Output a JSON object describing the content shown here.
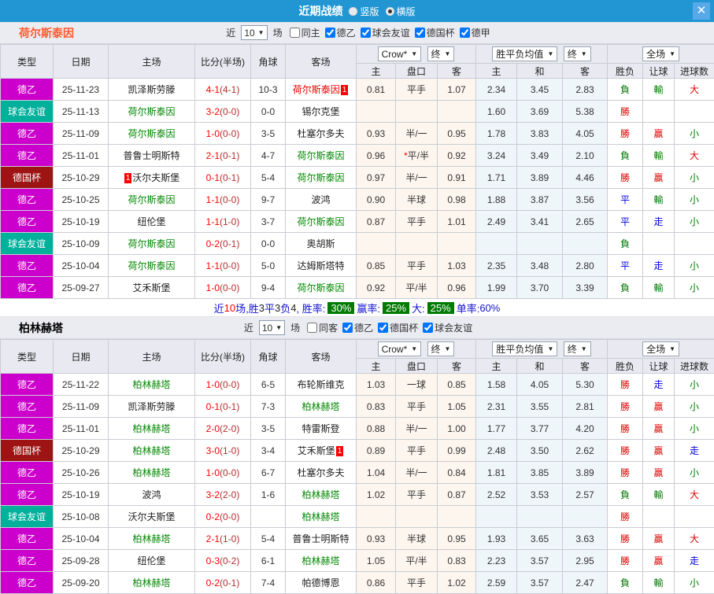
{
  "titlebar": {
    "title": "近期战绩",
    "radios": [
      {
        "label": "竖版",
        "selected": false
      },
      {
        "label": "横版",
        "selected": true
      }
    ],
    "close": "✕"
  },
  "table_header": {
    "cols": [
      "类型",
      "日期",
      "主场",
      "比分(半场)",
      "角球",
      "客场"
    ],
    "dropdowns": {
      "crow": "Crow*",
      "final1": "终",
      "avg": "胜平负均值",
      "final2": "终",
      "scope": "全场"
    },
    "sub": [
      "主",
      "盘口",
      "客",
      "主",
      "和",
      "客",
      "胜负",
      "让球",
      "进球数"
    ]
  },
  "colors": {
    "topbar": "#2196d3",
    "league": {
      "德乙": "#cc00cc",
      "球会友谊": "#00b09b",
      "德国杯": "#9e1414"
    },
    "team": {
      "green": "#008800",
      "red": "#e60000",
      "black": "#222222"
    },
    "result": {
      "red": "#e00000",
      "green": "#007a00",
      "blue": "#0000dd"
    },
    "title_orange": "#ff5a2a",
    "title_black": "#000000"
  },
  "sections": [
    {
      "team": "荷尔斯泰因",
      "team_color": "#ff5a2a",
      "filter": {
        "near": "近",
        "count": "10",
        "matches": "场",
        "checks": [
          {
            "label": "同主",
            "checked": false
          },
          {
            "label": "德乙",
            "checked": true
          },
          {
            "label": "球会友谊",
            "checked": true
          },
          {
            "label": "德国杯",
            "checked": true
          },
          {
            "label": "德甲",
            "checked": true
          }
        ]
      },
      "rows": [
        {
          "type": "德乙",
          "date": "25-11-23",
          "home": {
            "name": "凯泽斯劳滕",
            "color": "black"
          },
          "score": "4-1",
          "half": "(4-1)",
          "corner": "10-3",
          "away": {
            "name": "荷尔斯泰因",
            "color": "red",
            "badge": "1",
            "badge_pos": "after"
          },
          "odds": [
            "0.81",
            "平手",
            "1.07",
            "2.34",
            "3.45",
            "2.83"
          ],
          "results": [
            {
              "t": "負",
              "c": "green"
            },
            {
              "t": "輸",
              "c": "green"
            },
            {
              "t": "大",
              "c": "red"
            }
          ]
        },
        {
          "type": "球会友谊",
          "date": "25-11-13",
          "home": {
            "name": "荷尔斯泰因",
            "color": "green"
          },
          "score": "3-2",
          "half": "(0-0)",
          "corner": "0-0",
          "away": {
            "name": "锡尔克堡",
            "color": "black"
          },
          "odds": [
            "",
            "",
            "",
            "1.60",
            "3.69",
            "5.38"
          ],
          "results": [
            {
              "t": "勝",
              "c": "red"
            },
            null,
            null
          ]
        },
        {
          "type": "德乙",
          "date": "25-11-09",
          "home": {
            "name": "荷尔斯泰因",
            "color": "green"
          },
          "score": "1-0",
          "half": "(0-0)",
          "corner": "3-5",
          "away": {
            "name": "杜塞尔多夫",
            "color": "black"
          },
          "odds": [
            "0.93",
            "半/一",
            "0.95",
            "1.78",
            "3.83",
            "4.05"
          ],
          "results": [
            {
              "t": "勝",
              "c": "red"
            },
            {
              "t": "贏",
              "c": "red"
            },
            {
              "t": "小",
              "c": "green"
            }
          ]
        },
        {
          "type": "德乙",
          "date": "25-11-01",
          "home": {
            "name": "普鲁士明斯特",
            "color": "black"
          },
          "score": "2-1",
          "half": "(0-1)",
          "corner": "4-7",
          "away": {
            "name": "荷尔斯泰因",
            "color": "green"
          },
          "odds": [
            "0.96",
            "*平/半",
            "0.92",
            "3.24",
            "3.49",
            "2.10"
          ],
          "results": [
            {
              "t": "負",
              "c": "green"
            },
            {
              "t": "輸",
              "c": "green"
            },
            {
              "t": "大",
              "c": "red"
            }
          ]
        },
        {
          "type": "德国杯",
          "date": "25-10-29",
          "home": {
            "name": "沃尔夫斯堡",
            "color": "black",
            "badge": "1",
            "badge_pos": "before"
          },
          "score": "0-1",
          "half": "(0-1)",
          "corner": "5-4",
          "away": {
            "name": "荷尔斯泰因",
            "color": "green"
          },
          "odds": [
            "0.97",
            "半/一",
            "0.91",
            "1.71",
            "3.89",
            "4.46"
          ],
          "results": [
            {
              "t": "勝",
              "c": "red"
            },
            {
              "t": "贏",
              "c": "red"
            },
            {
              "t": "小",
              "c": "green"
            }
          ]
        },
        {
          "type": "德乙",
          "date": "25-10-25",
          "home": {
            "name": "荷尔斯泰因",
            "color": "green"
          },
          "score": "1-1",
          "half": "(0-0)",
          "corner": "9-7",
          "away": {
            "name": "波鸿",
            "color": "black"
          },
          "odds": [
            "0.90",
            "半球",
            "0.98",
            "1.88",
            "3.87",
            "3.56"
          ],
          "results": [
            {
              "t": "平",
              "c": "blue"
            },
            {
              "t": "輸",
              "c": "green"
            },
            {
              "t": "小",
              "c": "green"
            }
          ]
        },
        {
          "type": "德乙",
          "date": "25-10-19",
          "home": {
            "name": "纽伦堡",
            "color": "black"
          },
          "score": "1-1",
          "half": "(1-0)",
          "corner": "3-7",
          "away": {
            "name": "荷尔斯泰因",
            "color": "green"
          },
          "odds": [
            "0.87",
            "平手",
            "1.01",
            "2.49",
            "3.41",
            "2.65"
          ],
          "results": [
            {
              "t": "平",
              "c": "blue"
            },
            {
              "t": "走",
              "c": "blue"
            },
            {
              "t": "小",
              "c": "green"
            }
          ]
        },
        {
          "type": "球会友谊",
          "date": "25-10-09",
          "home": {
            "name": "荷尔斯泰因",
            "color": "green"
          },
          "score": "0-2",
          "half": "(0-1)",
          "corner": "0-0",
          "away": {
            "name": "奥胡斯",
            "color": "black"
          },
          "odds": [
            "",
            "",
            "",
            "",
            "",
            ""
          ],
          "results": [
            {
              "t": "負",
              "c": "green"
            },
            null,
            null
          ]
        },
        {
          "type": "德乙",
          "date": "25-10-04",
          "home": {
            "name": "荷尔斯泰因",
            "color": "green"
          },
          "score": "1-1",
          "half": "(0-0)",
          "corner": "5-0",
          "away": {
            "name": "达姆斯塔特",
            "color": "black"
          },
          "odds": [
            "0.85",
            "平手",
            "1.03",
            "2.35",
            "3.48",
            "2.80"
          ],
          "results": [
            {
              "t": "平",
              "c": "blue"
            },
            {
              "t": "走",
              "c": "blue"
            },
            {
              "t": "小",
              "c": "green"
            }
          ]
        },
        {
          "type": "德乙",
          "date": "25-09-27",
          "home": {
            "name": "艾禾斯堡",
            "color": "black"
          },
          "score": "1-0",
          "half": "(0-0)",
          "corner": "9-4",
          "away": {
            "name": "荷尔斯泰因",
            "color": "green"
          },
          "odds": [
            "0.92",
            "平/半",
            "0.96",
            "1.99",
            "3.70",
            "3.39"
          ],
          "results": [
            {
              "t": "負",
              "c": "green"
            },
            {
              "t": "輸",
              "c": "green"
            },
            {
              "t": "小",
              "c": "green"
            }
          ]
        }
      ],
      "summary": [
        {
          "t": "近",
          "c": "blue"
        },
        {
          "t": "10",
          "c": "red"
        },
        {
          "t": "场,胜",
          "c": "blue"
        },
        {
          "t": "3",
          "c": "dark"
        },
        {
          "t": "平",
          "c": "blue"
        },
        {
          "t": "3",
          "c": "dark"
        },
        {
          "t": "负",
          "c": "blue"
        },
        {
          "t": "4",
          "c": "dark"
        },
        {
          "t": ", 胜率:",
          "c": "blue"
        },
        {
          "t": "30%",
          "c": "badge"
        },
        {
          "t": "赢率:",
          "c": "blue"
        },
        {
          "t": "25%",
          "c": "badge"
        },
        {
          "t": "大:",
          "c": "blue"
        },
        {
          "t": "25%",
          "c": "badge"
        },
        {
          "t": "单率:",
          "c": "blue"
        },
        {
          "t": "60%",
          "c": "blue"
        }
      ]
    },
    {
      "team": "柏林赫塔",
      "team_color": "#000000",
      "filter": {
        "near": "近",
        "count": "10",
        "matches": "场",
        "checks": [
          {
            "label": "同客",
            "checked": false
          },
          {
            "label": "德乙",
            "checked": true
          },
          {
            "label": "德国杯",
            "checked": true
          },
          {
            "label": "球会友谊",
            "checked": true
          }
        ]
      },
      "rows": [
        {
          "type": "德乙",
          "date": "25-11-22",
          "home": {
            "name": "柏林赫塔",
            "color": "green"
          },
          "score": "1-0",
          "half": "(0-0)",
          "corner": "6-5",
          "away": {
            "name": "布轮斯维克",
            "color": "black"
          },
          "odds": [
            "1.03",
            "一球",
            "0.85",
            "1.58",
            "4.05",
            "5.30"
          ],
          "results": [
            {
              "t": "勝",
              "c": "red"
            },
            {
              "t": "走",
              "c": "blue"
            },
            {
              "t": "小",
              "c": "green"
            }
          ]
        },
        {
          "type": "德乙",
          "date": "25-11-09",
          "home": {
            "name": "凯泽斯劳滕",
            "color": "black"
          },
          "score": "0-1",
          "half": "(0-1)",
          "corner": "7-3",
          "away": {
            "name": "柏林赫塔",
            "color": "green"
          },
          "odds": [
            "0.83",
            "平手",
            "1.05",
            "2.31",
            "3.55",
            "2.81"
          ],
          "results": [
            {
              "t": "勝",
              "c": "red"
            },
            {
              "t": "贏",
              "c": "red"
            },
            {
              "t": "小",
              "c": "green"
            }
          ]
        },
        {
          "type": "德乙",
          "date": "25-11-01",
          "home": {
            "name": "柏林赫塔",
            "color": "green"
          },
          "score": "2-0",
          "half": "(2-0)",
          "corner": "3-5",
          "away": {
            "name": "特雷斯登",
            "color": "black"
          },
          "odds": [
            "0.88",
            "半/一",
            "1.00",
            "1.77",
            "3.77",
            "4.20"
          ],
          "results": [
            {
              "t": "勝",
              "c": "red"
            },
            {
              "t": "贏",
              "c": "red"
            },
            {
              "t": "小",
              "c": "green"
            }
          ]
        },
        {
          "type": "德国杯",
          "date": "25-10-29",
          "home": {
            "name": "柏林赫塔",
            "color": "green"
          },
          "score": "3-0",
          "half": "(1-0)",
          "corner": "3-4",
          "away": {
            "name": "艾禾斯堡",
            "color": "black",
            "badge": "1",
            "badge_pos": "after"
          },
          "odds": [
            "0.89",
            "平手",
            "0.99",
            "2.48",
            "3.50",
            "2.62"
          ],
          "results": [
            {
              "t": "勝",
              "c": "red"
            },
            {
              "t": "贏",
              "c": "red"
            },
            {
              "t": "走",
              "c": "blue"
            }
          ]
        },
        {
          "type": "德乙",
          "date": "25-10-26",
          "home": {
            "name": "柏林赫塔",
            "color": "green"
          },
          "score": "1-0",
          "half": "(0-0)",
          "corner": "6-7",
          "away": {
            "name": "杜塞尔多夫",
            "color": "black"
          },
          "odds": [
            "1.04",
            "半/一",
            "0.84",
            "1.81",
            "3.85",
            "3.89"
          ],
          "results": [
            {
              "t": "勝",
              "c": "red"
            },
            {
              "t": "贏",
              "c": "red"
            },
            {
              "t": "小",
              "c": "green"
            }
          ]
        },
        {
          "type": "德乙",
          "date": "25-10-19",
          "home": {
            "name": "波鸿",
            "color": "black"
          },
          "score": "3-2",
          "half": "(2-0)",
          "corner": "1-6",
          "away": {
            "name": "柏林赫塔",
            "color": "green"
          },
          "odds": [
            "1.02",
            "平手",
            "0.87",
            "2.52",
            "3.53",
            "2.57"
          ],
          "results": [
            {
              "t": "負",
              "c": "green"
            },
            {
              "t": "輸",
              "c": "green"
            },
            {
              "t": "大",
              "c": "red"
            }
          ]
        },
        {
          "type": "球会友谊",
          "date": "25-10-08",
          "home": {
            "name": "沃尔夫斯堡",
            "color": "black"
          },
          "score": "0-2",
          "half": "(0-0)",
          "corner": "",
          "away": {
            "name": "柏林赫塔",
            "color": "green"
          },
          "odds": [
            "",
            "",
            "",
            "",
            "",
            ""
          ],
          "results": [
            {
              "t": "勝",
              "c": "red"
            },
            null,
            null
          ]
        },
        {
          "type": "德乙",
          "date": "25-10-04",
          "home": {
            "name": "柏林赫塔",
            "color": "green"
          },
          "score": "2-1",
          "half": "(1-0)",
          "corner": "5-4",
          "away": {
            "name": "普鲁士明斯特",
            "color": "black"
          },
          "odds": [
            "0.93",
            "半球",
            "0.95",
            "1.93",
            "3.65",
            "3.63"
          ],
          "results": [
            {
              "t": "勝",
              "c": "red"
            },
            {
              "t": "贏",
              "c": "red"
            },
            {
              "t": "大",
              "c": "red"
            }
          ]
        },
        {
          "type": "德乙",
          "date": "25-09-28",
          "home": {
            "name": "纽伦堡",
            "color": "black"
          },
          "score": "0-3",
          "half": "(0-2)",
          "corner": "6-1",
          "away": {
            "name": "柏林赫塔",
            "color": "green"
          },
          "odds": [
            "1.05",
            "平/半",
            "0.83",
            "2.23",
            "3.57",
            "2.95"
          ],
          "results": [
            {
              "t": "勝",
              "c": "red"
            },
            {
              "t": "贏",
              "c": "red"
            },
            {
              "t": "走",
              "c": "blue"
            }
          ]
        },
        {
          "type": "德乙",
          "date": "25-09-20",
          "home": {
            "name": "柏林赫塔",
            "color": "green"
          },
          "score": "0-2",
          "half": "(0-1)",
          "corner": "7-4",
          "away": {
            "name": "帕德博恩",
            "color": "black"
          },
          "odds": [
            "0.86",
            "平手",
            "1.02",
            "2.59",
            "3.57",
            "2.47"
          ],
          "results": [
            {
              "t": "負",
              "c": "green"
            },
            {
              "t": "輸",
              "c": "green"
            },
            {
              "t": "小",
              "c": "green"
            }
          ]
        }
      ],
      "summary": null
    }
  ]
}
